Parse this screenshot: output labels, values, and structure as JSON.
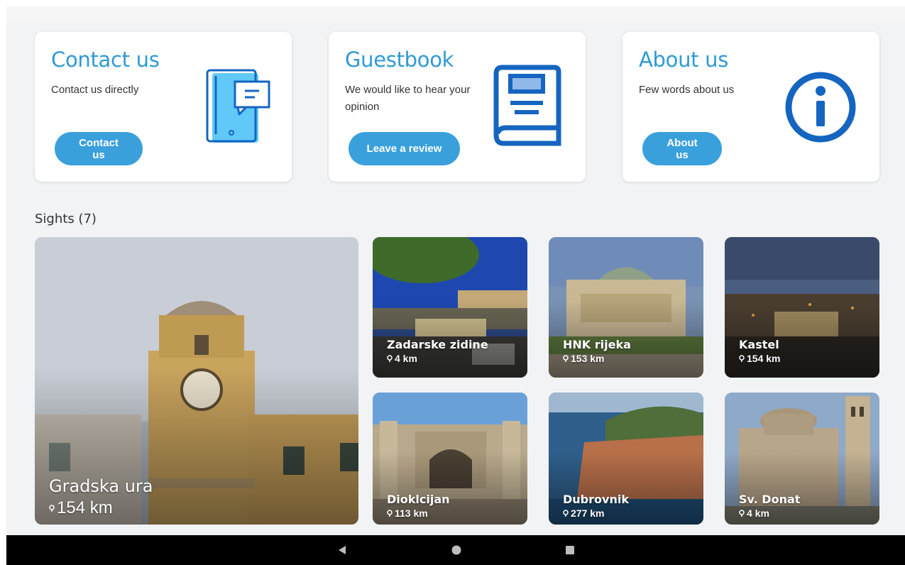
{
  "cards": [
    {
      "title": "Contact us",
      "description": "Contact us directly",
      "button": "Contact us",
      "icon": "chat-phone-icon"
    },
    {
      "title": "Guestbook",
      "description": "We would like to hear your opinion",
      "button": "Leave a review",
      "icon": "book-icon"
    },
    {
      "title": "About us",
      "description": "Few words about us",
      "button": "About us",
      "icon": "info-icon"
    }
  ],
  "sights": {
    "heading": "Sights (7)",
    "items": [
      {
        "name": "Gradska ura",
        "distance": "154 km"
      },
      {
        "name": "Zadarske zidine",
        "distance": "4 km"
      },
      {
        "name": "HNK rijeka",
        "distance": "153 km"
      },
      {
        "name": "Kastel",
        "distance": "154 km"
      },
      {
        "name": "Dioklcijan",
        "distance": "113 km"
      },
      {
        "name": "Dubrovnik",
        "distance": "277 km"
      },
      {
        "name": "Sv. Donat",
        "distance": "4 km"
      }
    ]
  },
  "colors": {
    "accent": "#2e9ad6",
    "button": "#3aa0dc",
    "icon_blue": "#1565c0",
    "icon_light": "#4fc3f7"
  },
  "nav": {
    "back": "back-icon",
    "home": "home-icon",
    "recents": "recents-icon"
  }
}
